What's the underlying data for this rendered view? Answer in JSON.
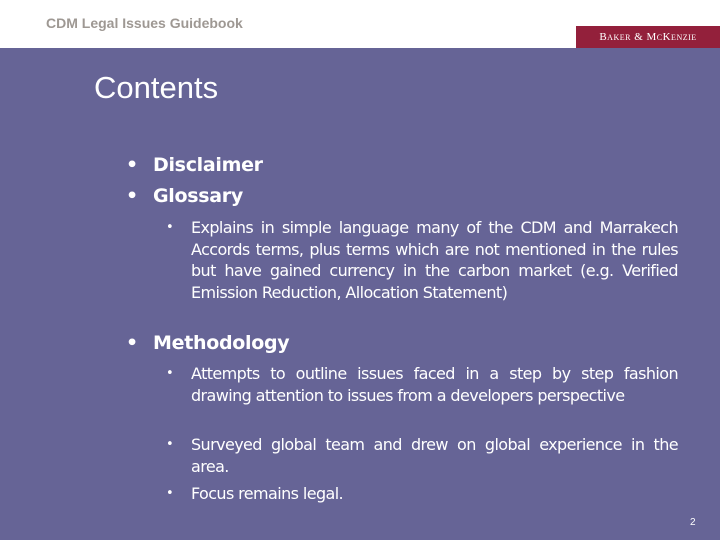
{
  "header": {
    "title": "CDM Legal Issues Guidebook",
    "logo_text": "Baker & McKenzie",
    "logo_color": "#93203b"
  },
  "slide": {
    "title": "Contents",
    "background_color": "#666496",
    "bullet_glyph": "•",
    "items": [
      {
        "label": "Disclaimer",
        "subitems": []
      },
      {
        "label": "Glossary",
        "subitems": [
          "Explains in simple language many of the CDM and Marrakech Accords terms, plus terms which are not mentioned in the rules but have gained currency in the carbon market (e.g. Verified Emission Reduction, Allocation Statement)"
        ]
      },
      {
        "label": "Methodology",
        "subitems": [
          "Attempts to outline issues faced in a step by step fashion drawing attention to issues from a developers perspective",
          "Surveyed global team and drew on global experience in the area.",
          "Focus remains legal."
        ]
      }
    ]
  },
  "footer": {
    "page_number": "2"
  }
}
